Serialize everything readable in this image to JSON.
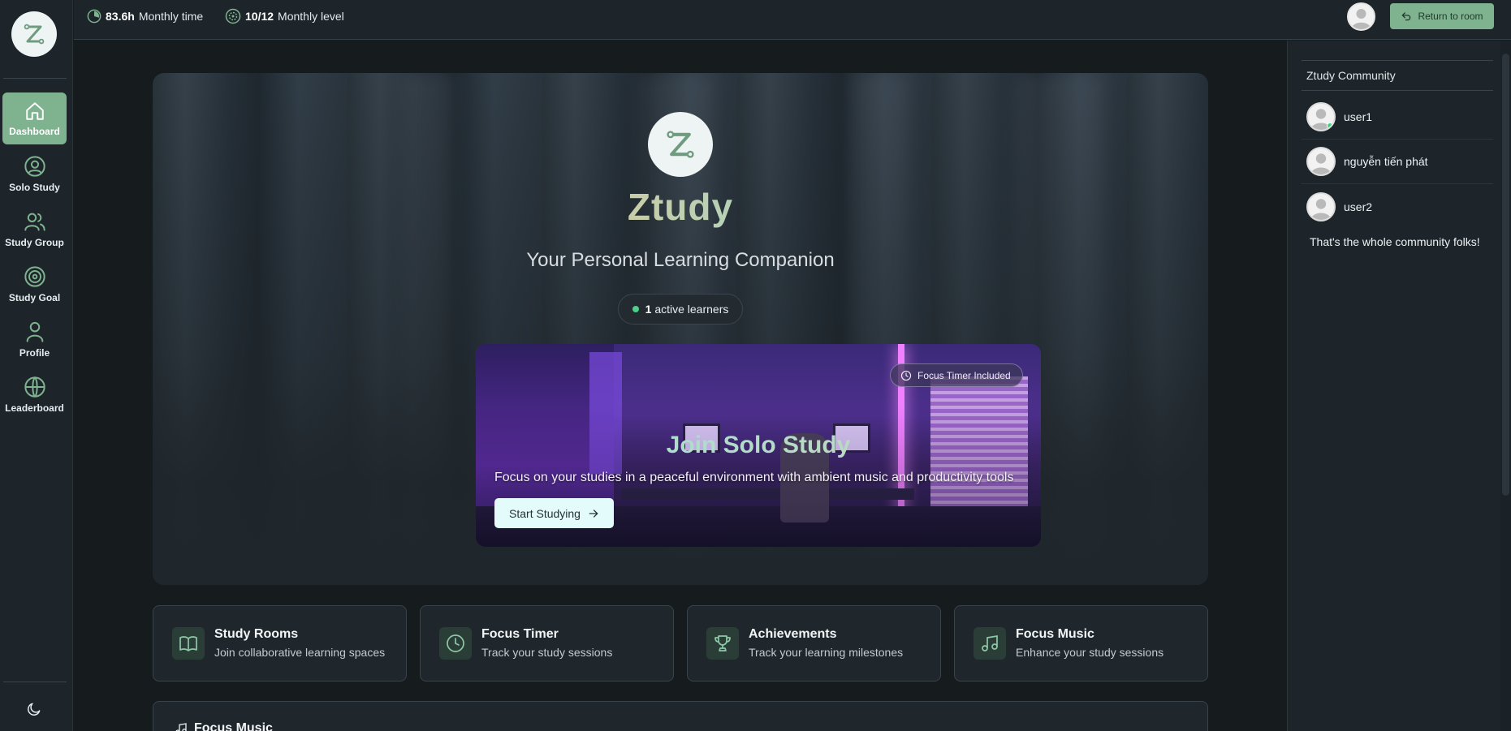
{
  "sidebar": {
    "items": [
      {
        "label": "Dashboard",
        "icon": "home-icon",
        "active": true
      },
      {
        "label": "Solo Study",
        "icon": "user-circle-icon",
        "active": false
      },
      {
        "label": "Study Group",
        "icon": "users-icon",
        "active": false
      },
      {
        "label": "Study Goal",
        "icon": "target-icon",
        "active": false
      },
      {
        "label": "Profile",
        "icon": "user-icon",
        "active": false
      },
      {
        "label": "Leaderboard",
        "icon": "globe-icon",
        "active": false
      }
    ],
    "theme_icon": "moon-icon"
  },
  "topbar": {
    "monthly_time_value": "83.6h",
    "monthly_time_label": "Monthly time",
    "monthly_level_value": "10/12",
    "monthly_level_label": "Monthly level",
    "return_label": "Return to room"
  },
  "hero": {
    "title": "Ztudy",
    "subtitle": "Your Personal Learning Companion",
    "active_count": "1",
    "active_label": "active learners"
  },
  "solo_card": {
    "badge": "Focus Timer Included",
    "title": "Join Solo Study",
    "description": "Focus on your studies in a peaceful environment with ambient music and productivity tools",
    "button": "Start Studying"
  },
  "features": [
    {
      "title": "Study Rooms",
      "desc": "Join collaborative learning spaces",
      "icon": "book-open-icon"
    },
    {
      "title": "Focus Timer",
      "desc": "Track your study sessions",
      "icon": "clock-icon"
    },
    {
      "title": "Achievements",
      "desc": "Track your learning milestones",
      "icon": "trophy-icon"
    },
    {
      "title": "Focus Music",
      "desc": "Enhance your study sessions",
      "icon": "music-icon"
    }
  ],
  "music_panel": {
    "title": "Focus Music"
  },
  "community": {
    "title": "Ztudy Community",
    "users": [
      {
        "name": "user1",
        "online": true
      },
      {
        "name": "nguyễn tiến phát",
        "online": false
      },
      {
        "name": "user2",
        "online": false
      }
    ],
    "end_message": "That's the whole community folks!"
  },
  "colors": {
    "accent": "#7fb28f",
    "background": "#161b1e",
    "panel": "#1d252b",
    "online": "#3ed27f"
  }
}
